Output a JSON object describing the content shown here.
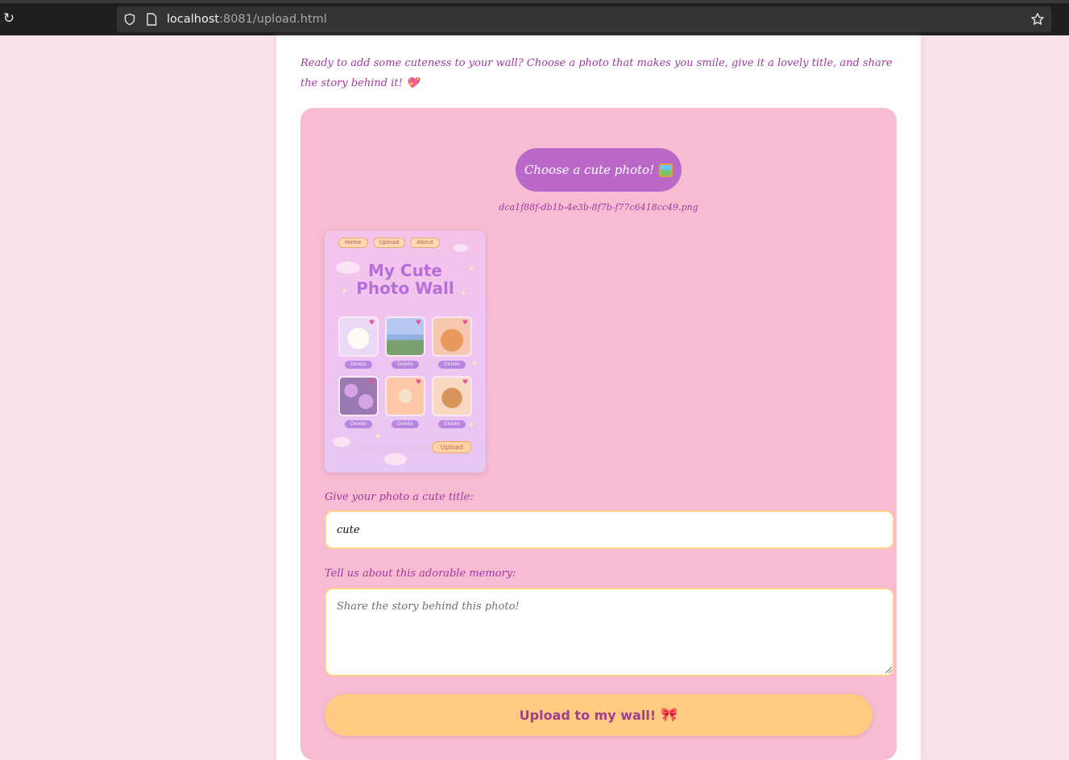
{
  "browser": {
    "url_host": "localhost",
    "url_rest": ":8081/upload.html"
  },
  "page": {
    "intro": "Ready to add some cuteness to your wall? Choose a photo that makes you smile, give it a lovely title, and share the story behind it! 💖",
    "choose_button": "Choose a cute photo!",
    "filename": "dca1f88f-db1b-4e3b-8f7b-f77c6418cc49.png",
    "title_label": "Give your photo a cute title:",
    "title_value": "cute",
    "story_label": "Tell us about this adorable memory:",
    "story_placeholder": "Share the story behind this photo!",
    "submit_label": "Upload to my wall!",
    "submit_emoji": "🎀"
  },
  "preview": {
    "nav": [
      "Home",
      "Upload",
      "About"
    ],
    "title_line1": "My Cute",
    "title_line2": "Photo Wall",
    "tiles": [
      {
        "delete": "Delete",
        "colors": [
          "#e9d8f6",
          "#fffaf4"
        ]
      },
      {
        "delete": "Delete",
        "colors": [
          "#b8c8f0",
          "#7aa070"
        ]
      },
      {
        "delete": "Delete",
        "colors": [
          "#f6c8b0",
          "#e89a5e"
        ]
      },
      {
        "delete": "Delete",
        "colors": [
          "#9a7ab0",
          "#d8a4e8"
        ]
      },
      {
        "delete": "Delete",
        "colors": [
          "#ffc8a8",
          "#f6e2c8"
        ]
      },
      {
        "delete": "Delete",
        "colors": [
          "#f8d8c0",
          "#d8945a"
        ]
      }
    ],
    "upload": "Upload"
  }
}
